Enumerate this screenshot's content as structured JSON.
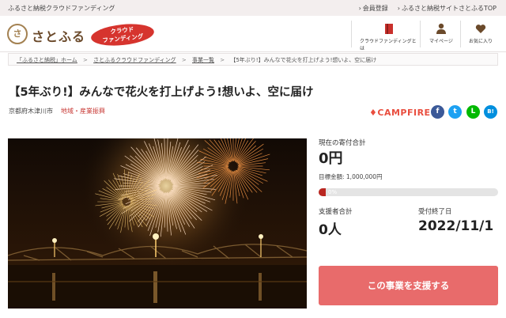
{
  "topbar": {
    "tagline": "ふるさと納税クラウドファンディング",
    "links": [
      "会員登録",
      "ふるさと納税サイトさとふるTOP"
    ]
  },
  "header": {
    "logo_mark": "さ",
    "logo_text": "さとふる",
    "badge_line1": "クラウド",
    "badge_line2": "ファンディング",
    "nav": [
      {
        "label": "クラウドファンディングとは",
        "icon": "book-icon"
      },
      {
        "label": "マイページ",
        "icon": "person-icon"
      },
      {
        "label": "お気に入り",
        "icon": "heart-icon"
      }
    ]
  },
  "breadcrumb": [
    "「ふるさと納税」ホーム",
    "さとふるクラウドファンディング",
    "事業一覧",
    "【5年ぶり!】みんなで花火を打上げよう!想いよ、空に届け"
  ],
  "project": {
    "title": "【5年ぶり!】みんなで花火を打上げよう!想いよ、空に届け",
    "municipality": "京都府木津川市",
    "category": "地域・産業振興",
    "partner_logo": "CAMPFIRE",
    "hero_alt": "fireworks-over-bridge"
  },
  "social": [
    {
      "name": "facebook-icon",
      "glyph": "f",
      "color": "#3b5998"
    },
    {
      "name": "twitter-icon",
      "glyph": "t",
      "color": "#1da1f2"
    },
    {
      "name": "line-icon",
      "glyph": "L",
      "color": "#00b900"
    },
    {
      "name": "hatena-icon",
      "glyph": "B!",
      "color": "#008fde"
    }
  ],
  "stats": {
    "current_label": "現在の寄付合計",
    "current_amount": "0円",
    "target_label": "目標金額: 1,000,000円",
    "progress_percent": 0,
    "progress_text": "0%",
    "supporters_label": "支援者合計",
    "supporters_value": "0人",
    "deadline_label": "受付終了日",
    "deadline_value": "2022/11/1"
  },
  "support_button": "この事業を支援する"
}
